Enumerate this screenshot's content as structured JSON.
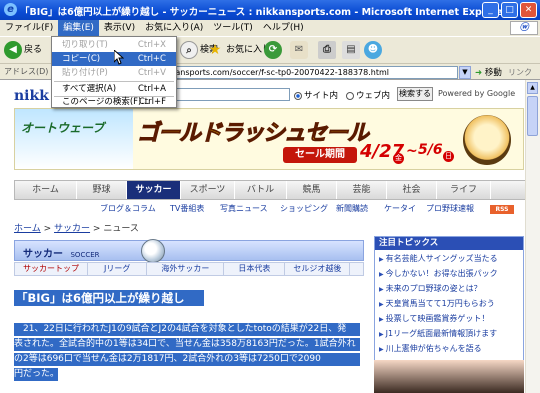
{
  "window": {
    "title": "「BIG」は6億円以上が繰り越し - サッカーニュース : nikkansports.com - Microsoft Internet Explorer"
  },
  "menubar": {
    "items": [
      "ファイル(F)",
      "編集(E)",
      "表示(V)",
      "お気に入り(A)",
      "ツール(T)",
      "ヘルプ(H)"
    ],
    "active_index": 1
  },
  "toolbar": {
    "back_label": "戻る",
    "search_label": "検索",
    "favorites_label": "お気に入り"
  },
  "addressbar": {
    "label": "アドレス(D)",
    "url": "http://www.nikkansports.com/soccer/f-sc-tp0-20070422-188378.html",
    "go_label": "移動",
    "links_label": "リンク"
  },
  "edit_menu": {
    "items": [
      {
        "label": "切り取り(T)",
        "shortcut": "Ctrl+X",
        "state": "disabled"
      },
      {
        "label": "コピー(C)",
        "shortcut": "Ctrl+C",
        "state": "highlighted"
      },
      {
        "label": "貼り付け(P)",
        "shortcut": "Ctrl+V",
        "state": "disabled"
      },
      {
        "label": "すべて選択(A)",
        "shortcut": "Ctrl+A",
        "state": "enabled"
      },
      {
        "label": "このページの検索(F)...",
        "shortcut": "Ctrl+F",
        "state": "enabled"
      }
    ]
  },
  "site": {
    "logo": "nikk",
    "search_options": [
      "サイト内",
      "ウェブ内"
    ],
    "search_button": "検索する",
    "powered_by": "Powered by Google"
  },
  "banner": {
    "brand": "オートウェーブ",
    "title": "ゴールドラッシュセール",
    "period": "セール期間",
    "date_start": "4/27",
    "date_start_day": "金",
    "date_end": "5/6",
    "date_end_day": "日"
  },
  "nav": {
    "items": [
      "ホーム",
      "野球",
      "サッカー",
      "スポーツ",
      "バトル",
      "競馬",
      "芸能",
      "社会",
      "ライフ"
    ],
    "active_index": 2
  },
  "subnav": {
    "items": [
      "ブログ＆コラム",
      "TV番組表",
      "写真ニュース",
      "ショッピング",
      "新聞購読",
      "ケータイ",
      "プロ野球速報"
    ],
    "rss": "RSS"
  },
  "breadcrumb": {
    "items": [
      "ホーム",
      "サッカー",
      "ニュース"
    ],
    "separator": ">"
  },
  "soccer": {
    "title": "サッカー",
    "title_en": "SOCCER",
    "tabs": [
      "サッカートップ",
      "Jリーグ",
      "海外サッカー",
      "日本代表",
      "セルジオ越後"
    ],
    "active_tab": 0
  },
  "article": {
    "headline": "「BIG」は6億円以上が繰り越し",
    "body_lines": [
      "　21、22日に行われたJ1の9試合とJ2の4試合を対象としたtotoの結果が22日、発",
      "表された。全試合的中の1等は34口で、当せん金は358万8163円だった。1試合外れ",
      "の2等は696口で当せん金は2万1817円、2試合外れの3等は7250口で2090",
      "円だった。"
    ]
  },
  "topics": {
    "heading": "注目トピックス",
    "items": [
      "有名芸能人サイングッズ当たる",
      "今しかない！お得な出張パック",
      "未来のプロ野球の姿とは？",
      "天皇賞馬当てて1万円もらおう",
      "投票して映画鑑賞券ゲット！",
      "J1リーグ紙面最新情報頂けます",
      "川上憲伸が佑ちゃんを語る"
    ]
  }
}
